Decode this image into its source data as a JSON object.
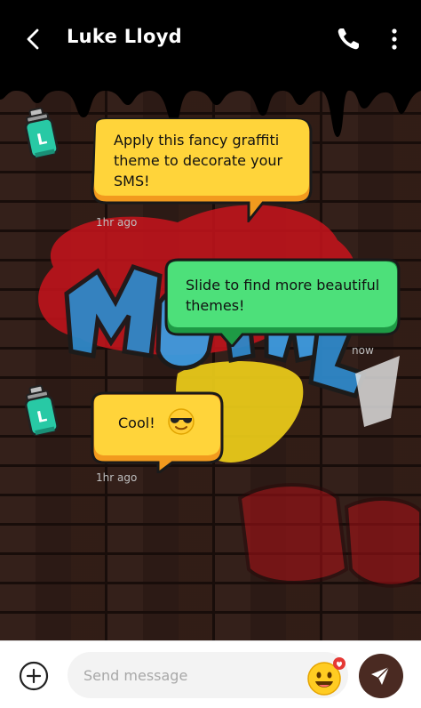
{
  "header": {
    "contact_name": "Luke Lloyd"
  },
  "messages": [
    {
      "side": "incoming",
      "lines": [
        "Apply this fancy graffiti",
        "theme to decorate your",
        "SMS!"
      ],
      "time": "1hr ago",
      "color": "#ffd43a"
    },
    {
      "side": "outgoing",
      "lines": [
        "Slide to find more beautiful",
        "themes!"
      ],
      "time": "now",
      "color": "#4de07a"
    },
    {
      "side": "incoming",
      "lines": [
        "Cool!"
      ],
      "emoji": "sunglasses-emoji",
      "time": "1hr ago",
      "color": "#ffd43a"
    }
  ],
  "avatar": {
    "letter": "L",
    "icon": "spray-can-icon"
  },
  "compose": {
    "placeholder": "Send message",
    "emoji_icon": "smiling-face-icon",
    "send_icon": "paper-plane-icon",
    "attach_icon": "plus-circle-icon"
  },
  "colors": {
    "bubble_incoming": "#ffd43a",
    "bubble_outgoing": "#4de07a",
    "bubble_shadow_incoming": "#f29a1e",
    "bubble_shadow_outgoing": "#1e9a45",
    "send_button": "#4a2a22",
    "header_bg": "#000000"
  }
}
